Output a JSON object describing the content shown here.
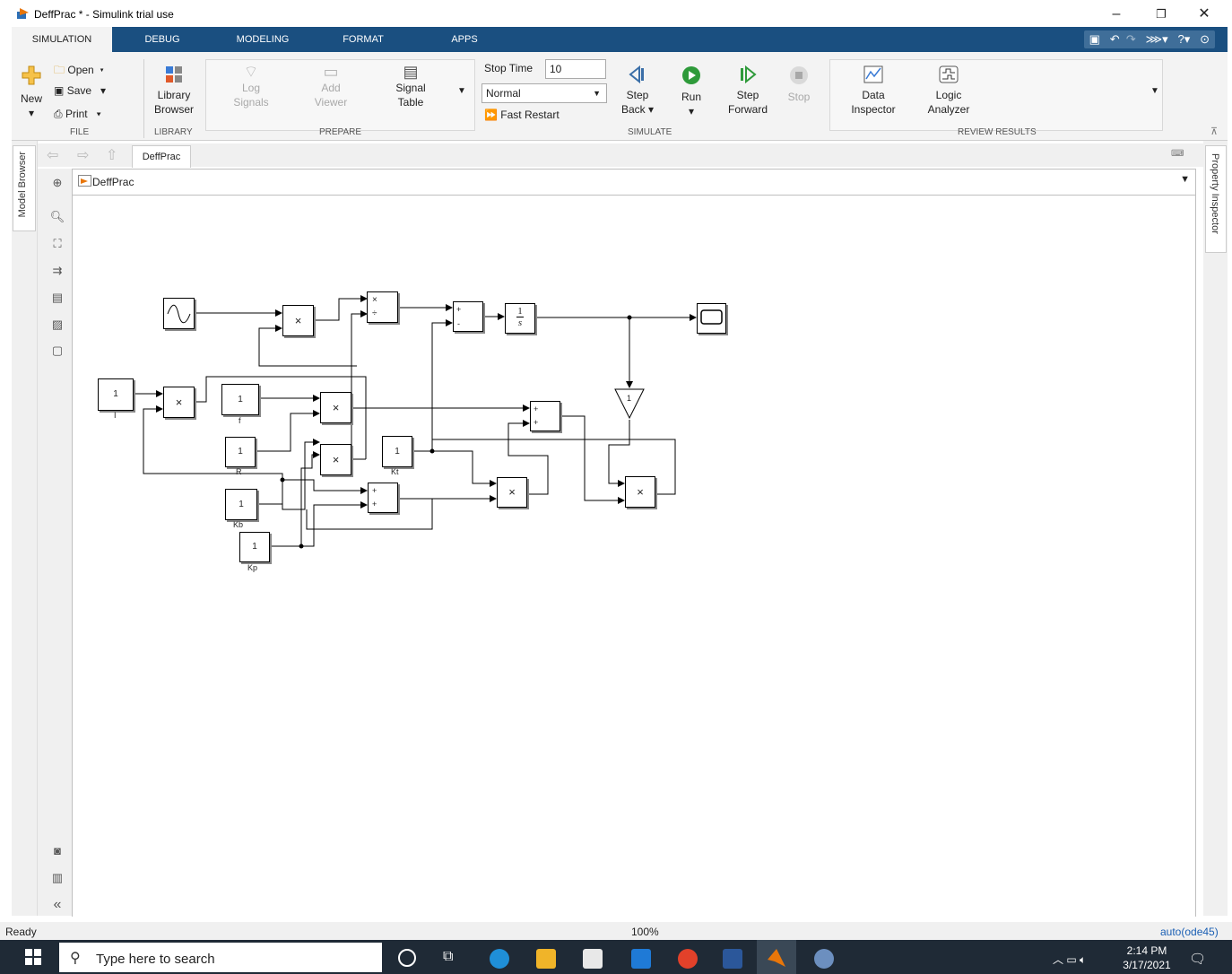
{
  "window": {
    "title": "DeffPrac * - Simulink trial use",
    "controls": [
      "–",
      "❐",
      "✕"
    ]
  },
  "ribbon_tabs": [
    "SIMULATION",
    "DEBUG",
    "MODELING",
    "FORMAT",
    "APPS"
  ],
  "active_tab": "SIMULATION",
  "file_group": {
    "label": "FILE",
    "new": "New",
    "open": "Open",
    "save": "Save",
    "print": "Print"
  },
  "library_group": {
    "label": "LIBRARY",
    "library_browser_1": "Library",
    "library_browser_2": "Browser"
  },
  "prepare_group": {
    "label": "PREPARE",
    "log_signals_1": "Log",
    "log_signals_2": "Signals",
    "add_viewer_1": "Add",
    "add_viewer_2": "Viewer",
    "signal_table_1": "Signal",
    "signal_table_2": "Table"
  },
  "simulate_group": {
    "label": "SIMULATE",
    "stop_time_label": "Stop Time",
    "stop_time_value": "10",
    "mode_value": "Normal",
    "fast_restart": "Fast Restart",
    "step_back_1": "Step",
    "step_back_2": "Back ▾",
    "run": "Run",
    "step_forward_1": "Step",
    "step_forward_2": "Forward",
    "stop": "Stop"
  },
  "review_group": {
    "label": "REVIEW RESULTS",
    "data_inspector_1": "Data",
    "data_inspector_2": "Inspector",
    "logic_analyzer_1": "Logic",
    "logic_analyzer_2": "Analyzer"
  },
  "side_panels": {
    "model_browser": "Model Browser",
    "property_inspector": "Property Inspector"
  },
  "model_tab": "DeffPrac",
  "model_path": "DeffPrac",
  "blocks": {
    "const_I": {
      "value": "1",
      "name": "I"
    },
    "const_f": {
      "value": "1",
      "name": "f"
    },
    "const_R": {
      "value": "1",
      "name": "R"
    },
    "const_Kb": {
      "value": "1",
      "name": "Kb"
    },
    "const_Kp": {
      "value": "1",
      "name": "Kp"
    },
    "const_Kt": {
      "value": "1",
      "name": "Kt"
    },
    "gain_value": "1",
    "product_symbol": "×",
    "divide_symbol": "÷",
    "integrator_num": "1",
    "integrator_den": "s",
    "plus": "+",
    "minus": "-"
  },
  "status": {
    "left": "Ready",
    "zoom": "100%",
    "solver": "auto(ode45)"
  },
  "taskbar": {
    "search_placeholder": "Type here to search",
    "time": "2:14 PM",
    "date": "3/17/2021"
  }
}
